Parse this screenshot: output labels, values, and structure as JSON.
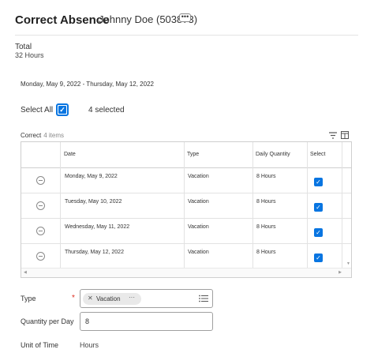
{
  "header": {
    "title": "Correct Absence",
    "worker": "Johnny Doe (503873)",
    "more_label": "•••"
  },
  "total": {
    "label": "Total",
    "value": "32 Hours"
  },
  "date_range": "Monday, May 9, 2022 - Thursday, May 12, 2022",
  "select_all": {
    "label": "Select All",
    "checked": true,
    "selected_count": "4 selected"
  },
  "grid": {
    "title": "Correct",
    "count": "4 items",
    "columns": [
      "Date",
      "Type",
      "Daily Quantity",
      "Select"
    ],
    "rows": [
      {
        "date": "Monday, May 9, 2022",
        "type": "Vacation",
        "quantity": "8 Hours",
        "selected": true
      },
      {
        "date": "Tuesday, May 10, 2022",
        "type": "Vacation",
        "quantity": "8 Hours",
        "selected": true
      },
      {
        "date": "Wednesday, May 11, 2022",
        "type": "Vacation",
        "quantity": "8 Hours",
        "selected": true
      },
      {
        "date": "Thursday, May 12, 2022",
        "type": "Vacation",
        "quantity": "8 Hours",
        "selected": true
      }
    ]
  },
  "form": {
    "type_label": "Type",
    "required_mark": "*",
    "type_value": "Vacation",
    "quantity_label": "Quantity per Day",
    "quantity_value": "8",
    "unit_label": "Unit of Time",
    "unit_value": "Hours"
  },
  "colors": {
    "accent": "#0875e1",
    "required": "#de2e21"
  },
  "icons": {
    "filter": "filter-icon",
    "columns": "columns-icon",
    "remove": "remove-row-icon",
    "list": "list-icon"
  }
}
